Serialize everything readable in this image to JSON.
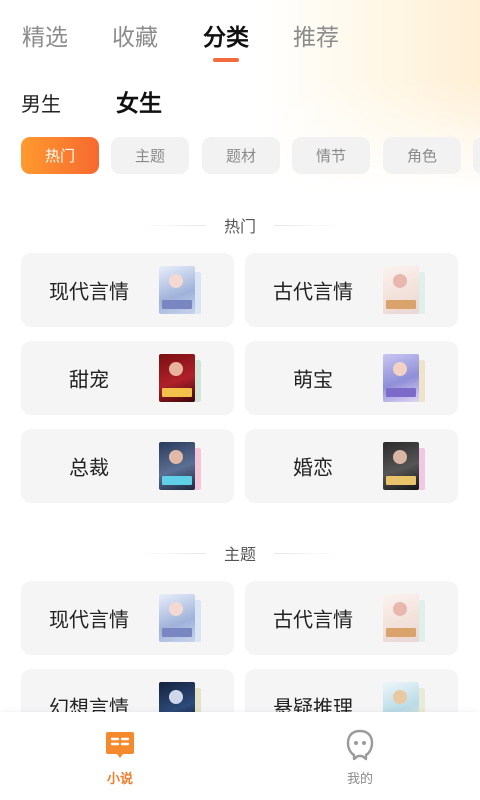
{
  "top_tabs": [
    {
      "label": "精选"
    },
    {
      "label": "收藏"
    },
    {
      "label": "分类"
    },
    {
      "label": "推荐"
    }
  ],
  "active_tab_index": 2,
  "gender": {
    "male": "男生",
    "female": "女生",
    "selected": "女生"
  },
  "filter_chips": [
    {
      "label": "热门"
    },
    {
      "label": "主题"
    },
    {
      "label": "题材"
    },
    {
      "label": "情节"
    },
    {
      "label": "角色"
    }
  ],
  "active_chip_index": 0,
  "sections": [
    {
      "title": "热门",
      "items": [
        {
          "label": "现代言情",
          "cover_icon": "book-cover"
        },
        {
          "label": "古代言情",
          "cover_icon": "book-cover"
        },
        {
          "label": "甜宠",
          "cover_icon": "book-cover"
        },
        {
          "label": "萌宝",
          "cover_icon": "book-cover"
        },
        {
          "label": "总裁",
          "cover_icon": "book-cover"
        },
        {
          "label": "婚恋",
          "cover_icon": "book-cover"
        }
      ]
    },
    {
      "title": "主题",
      "items": [
        {
          "label": "现代言情",
          "cover_icon": "book-cover"
        },
        {
          "label": "古代言情",
          "cover_icon": "book-cover"
        },
        {
          "label": "幻想言情",
          "cover_icon": "book-cover"
        },
        {
          "label": "悬疑推理",
          "cover_icon": "book-cover"
        }
      ]
    }
  ],
  "bottom_nav": [
    {
      "label": "小说",
      "icon": "book-icon",
      "active": true
    },
    {
      "label": "我的",
      "icon": "profile-icon",
      "active": false
    }
  ],
  "colors": {
    "accent": "#f26b3a",
    "chip_gradient_start": "#ff9a2e",
    "chip_gradient_end": "#f7692f",
    "card_bg": "#f5f5f6",
    "nav_active": "#f37b2a"
  }
}
